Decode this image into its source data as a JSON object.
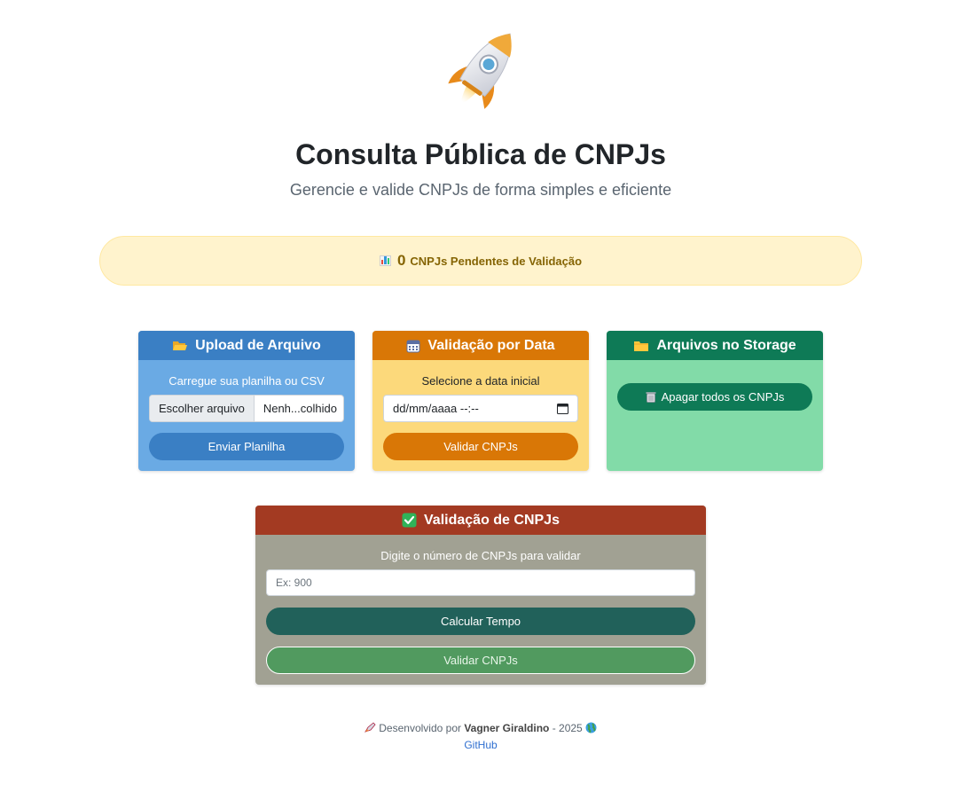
{
  "header": {
    "title": "Consulta Pública de CNPJs",
    "subtitle": "Gerencie e valide CNPJs de forma simples e eficiente"
  },
  "pending": {
    "count": "0",
    "label": "CNPJs Pendentes de Validação",
    "icon": "bar-chart-icon"
  },
  "upload_card": {
    "title": "Upload de Arquivo",
    "icon": "open-folder-icon",
    "label": "Carregue sua planilha ou CSV",
    "file_choose": "Escolher arquivo",
    "file_none": "Nenh...colhido",
    "submit": "Enviar Planilha",
    "header_color": "#3a7fc4",
    "body_color": "#6aaae4"
  },
  "date_card": {
    "title": "Validação por Data",
    "icon": "calendar-icon",
    "label": "Selecione a data inicial",
    "date_placeholder": "dd/mm/aaaa --:--",
    "submit": "Validar CNPJs",
    "header_color": "#d97706",
    "body_color": "#fcd97b"
  },
  "storage_card": {
    "title": "Arquivos no Storage",
    "icon": "folder-icon",
    "delete_button": "Apagar todos os CNPJs",
    "delete_icon": "trash-icon",
    "header_color": "#0e7a56",
    "body_color": "#82dba8"
  },
  "validation_card": {
    "title": "Validação de CNPJs",
    "icon": "check-icon",
    "label": "Digite o número de CNPJs para validar",
    "placeholder": "Ex: 900",
    "calc_button": "Calcular Tempo",
    "validate_button": "Validar CNPJs",
    "header_color": "#a33a22",
    "body_color": "#a1a193"
  },
  "footer": {
    "prefix": "Desenvolvido por",
    "author": "Vagner Giraldino",
    "suffix": "- 2025",
    "link": "GitHub"
  }
}
